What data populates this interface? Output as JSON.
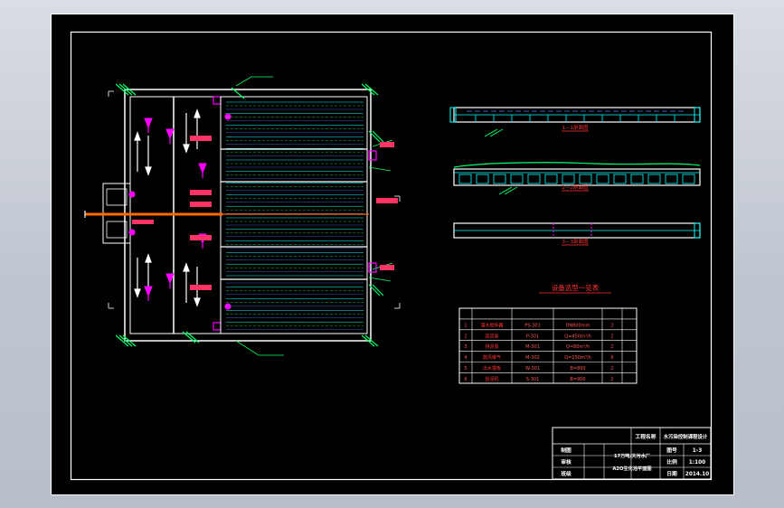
{
  "colors": {
    "background": "#000000",
    "frame": "#ffffff",
    "pipe": "#ff6a00",
    "magenta": "#ff00ff",
    "green": "#00ff66",
    "cyan": "#00ffff",
    "yellow": "#ffff00",
    "blue": "#4a7bff"
  },
  "section_labels": [
    "1—1剖面图",
    "2—2剖面图",
    "3—3剖面图"
  ],
  "equipment_table": {
    "title": "设备选型一览表",
    "rows": [
      [
        "1",
        "潜水搅拌器",
        "PS-301",
        "DN800mm",
        "2"
      ],
      [
        "2",
        "回流泵",
        "P-301",
        "Q=450m³/h",
        "2"
      ],
      [
        "3",
        "排泥泵",
        "M-301",
        "Q=80m³/h",
        "2"
      ],
      [
        "4",
        "鼓风曝气",
        "M-302",
        "Q=250m³/h",
        "6"
      ],
      [
        "5",
        "出水堰板",
        "W-301",
        "B=800",
        "2"
      ],
      [
        "6",
        "刮泥机",
        "S-301",
        "B=900",
        "2"
      ]
    ]
  },
  "title_block": {
    "project_label": "工程名称",
    "project_name": "水污染控制课程设计",
    "row1_left": "制图",
    "row2_left": "审核",
    "row3_left": "班级",
    "drawing_title_line1": "17万吨/天污水厂",
    "drawing_title_line2": "A2O生化池平面图",
    "sheet_label": "图号",
    "sheet_value": "1-3",
    "scale_label": "比例",
    "scale_value": "1:100",
    "date_label": "日期",
    "date_value": "2014.10"
  }
}
